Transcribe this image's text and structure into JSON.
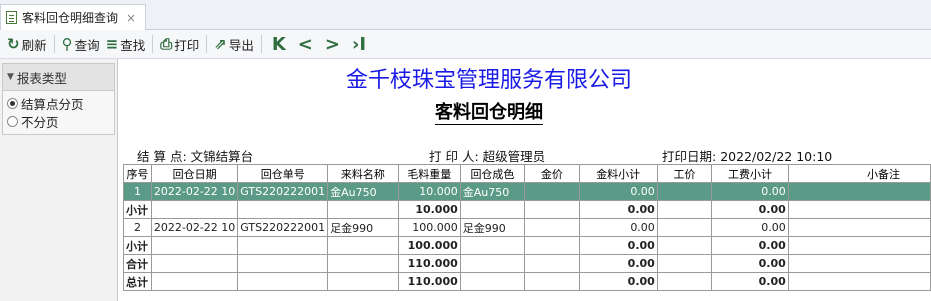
{
  "tab": {
    "title": "客料回仓明细查询",
    "close": "×"
  },
  "toolbar": {
    "refresh": "刷新",
    "query": "查询",
    "find": "查找",
    "print": "打印",
    "export": "导出",
    "nav_first": "K",
    "nav_prev": "<",
    "nav_next": ">",
    "nav_last": "›I"
  },
  "sidebar": {
    "panel_title": "报表类型",
    "options": [
      "结算点分页",
      "不分页"
    ],
    "selected": "结算点分页"
  },
  "report": {
    "company": "金千枝珠宝管理服务有限公司",
    "title": "客料回仓明细",
    "settle_point_label": "结 算 点:",
    "settle_point": "文锦结算台",
    "printer_label": "打 印 人:",
    "printer": "超级管理员",
    "print_date_label": "打印日期:",
    "print_date": "2022/02/22 10:10"
  },
  "table": {
    "headers": [
      "序号",
      "回仓日期",
      "回仓单号",
      "来料名称",
      "毛料重量",
      "回仓成色",
      "金价",
      "金料小计",
      "工价",
      "工费小计",
      "小备注"
    ],
    "rows": [
      {
        "type": "data",
        "selected": true,
        "cells": [
          "1",
          "2022-02-22 10",
          "GTS220222001",
          "金Au750",
          "10.000",
          "金Au750",
          "",
          "0.00",
          "",
          "0.00",
          ""
        ]
      },
      {
        "type": "sub",
        "cells": [
          "小计",
          "",
          "",
          "",
          "10.000",
          "",
          "",
          "0.00",
          "",
          "0.00",
          ""
        ]
      },
      {
        "type": "data",
        "selected": false,
        "cells": [
          "2",
          "2022-02-22 10",
          "GTS220222001",
          "足金990",
          "100.000",
          "足金990",
          "",
          "0.00",
          "",
          "0.00",
          ""
        ]
      },
      {
        "type": "sub",
        "cells": [
          "小计",
          "",
          "",
          "",
          "100.000",
          "",
          "",
          "0.00",
          "",
          "0.00",
          ""
        ]
      },
      {
        "type": "sub",
        "cells": [
          "合计",
          "",
          "",
          "",
          "110.000",
          "",
          "",
          "0.00",
          "",
          "0.00",
          ""
        ]
      },
      {
        "type": "sub",
        "cells": [
          "总计",
          "",
          "",
          "",
          "110.000",
          "",
          "",
          "0.00",
          "",
          "0.00",
          ""
        ]
      }
    ]
  },
  "colors": {
    "selected_row": "#5b9a86",
    "company_text": "#1a1ae6",
    "icon": "#2f6e3f"
  }
}
